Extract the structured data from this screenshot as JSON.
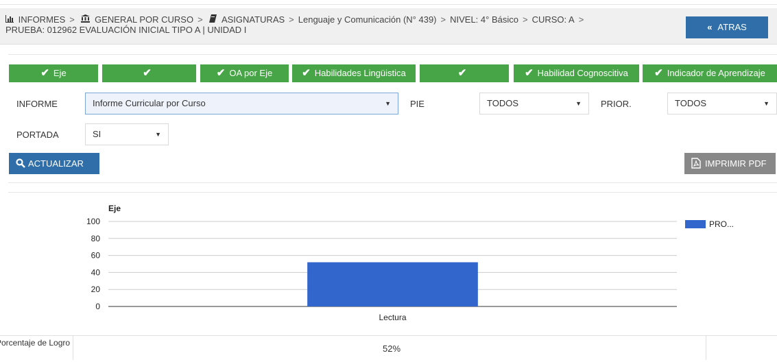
{
  "breadcrumb": {
    "informes": "INFORMES",
    "general": "GENERAL POR CURSO",
    "asignaturas": "ASIGNATURAS",
    "asignatura": "Lenguaje y Comunicación (N° 439)",
    "nivel": "NIVEL: 4° Básico",
    "curso": "CURSO: A",
    "prueba": "PRUEBA: 012962 EVALUACIÓN INICIAL TIPO A | UNIDAD I",
    "separator": ">"
  },
  "atras_label": "ATRAS",
  "tabs": [
    {
      "label": "Eje"
    },
    {
      "label": ""
    },
    {
      "label": "OA por Eje"
    },
    {
      "label": "Habilidades Lingüistica"
    },
    {
      "label": ""
    },
    {
      "label": "Habilidad Cognoscitiva"
    },
    {
      "label": "Indicador de Aprendizaje"
    }
  ],
  "filters": {
    "informe_label": "INFORME",
    "informe_value": "Informe Curricular por Curso",
    "pie_label": "PIE",
    "pie_value": "TODOS",
    "prior_label": "PRIOR.",
    "prior_value": "TODOS",
    "portada_label": "PORTADA",
    "portada_value": "SI"
  },
  "actualizar_label": "ACTUALIZAR",
  "imprimir_label": "IMPRIMIR PDF",
  "colors": {
    "accent_blue": "#2f6ea8",
    "tab_green": "#47a447",
    "bar_blue": "#3366cc",
    "pdf_gray": "#888888"
  },
  "chart_data": {
    "type": "bar",
    "title": "Eje",
    "categories": [
      "Lectura"
    ],
    "series": [
      {
        "name": "PRO...",
        "values": [
          52
        ]
      }
    ],
    "ylim": [
      0,
      100
    ],
    "yticks": [
      0,
      20,
      40,
      60,
      80,
      100
    ],
    "grid": true,
    "legend": "right"
  },
  "result": {
    "label": "Porcentaje de Logro",
    "value": "52%"
  }
}
